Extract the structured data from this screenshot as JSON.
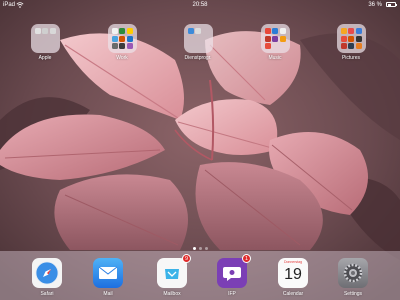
{
  "status_bar": {
    "carrier": "iPad",
    "time": "20:58",
    "battery_pct_label": "36 %",
    "battery_level": 0.36
  },
  "folders": [
    {
      "label": "Apple",
      "minis": [
        "#e1e1e1",
        "#cfcfcf",
        "#d8d8d8"
      ]
    },
    {
      "label": "Work",
      "minis": [
        "#f2f2f2",
        "#2e8b3c",
        "#ffcc00",
        "#4aa3df",
        "#d35400",
        "#1d75c9",
        "#6b6b6b",
        "#3c3c3c",
        "#9b59b6"
      ]
    },
    {
      "label": "Dienstprogr.",
      "minis": [
        "#3d8bd9",
        "#dcdcdc"
      ]
    },
    {
      "label": "Music",
      "minis": [
        "#e8473a",
        "#2b7dd6",
        "#f0f0f0",
        "#c0392b",
        "#7a3ea0",
        "#f39c12",
        "#e74c3c"
      ]
    },
    {
      "label": "Pictures",
      "minis": [
        "#f5a623",
        "#e84b4b",
        "#3b7dd8",
        "#e74c3c",
        "#d35400",
        "#333333",
        "#c0392b",
        "#2c3e50",
        "#e67e22"
      ]
    }
  ],
  "page_dots": {
    "count": 3,
    "active": 0
  },
  "dock": [
    {
      "label": "Safari",
      "icon": "safari-icon",
      "badge": ""
    },
    {
      "label": "Mail",
      "icon": "mail-icon",
      "badge": ""
    },
    {
      "label": "Mailbox",
      "icon": "mailbox-icon",
      "badge": "9"
    },
    {
      "label": "IFP",
      "icon": "chat-bubble-icon",
      "badge": "1"
    },
    {
      "label": "Calendar",
      "icon": "calendar-icon",
      "badge": "",
      "day": "Donnerstag",
      "date": "19"
    },
    {
      "label": "Settings",
      "icon": "gear-icon",
      "badge": ""
    }
  ]
}
